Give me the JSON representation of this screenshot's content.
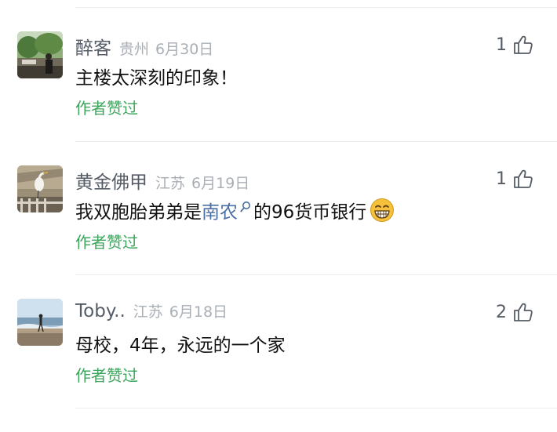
{
  "comments": [
    {
      "name": "醉客",
      "location": "贵州",
      "date": "6月30日",
      "text": "主楼太深刻的印象！",
      "author_liked": "作者赞过",
      "likes": "1",
      "avatar_icon": "avatar-photo-trees-person"
    },
    {
      "name": "黄金佛甲",
      "location": "江苏",
      "date": "6月19日",
      "text_before": "我双胞胎弟弟是",
      "link": "南农",
      "text_after": "的96货币银行",
      "emoji": "grinning-emoji",
      "author_liked": "作者赞过",
      "likes": "1",
      "avatar_icon": "avatar-photo-heron"
    },
    {
      "name": "Toby..",
      "location": "江苏",
      "date": "6月18日",
      "text": "母校，4年，永远的一个家",
      "author_liked": "作者赞过",
      "likes": "2",
      "avatar_icon": "avatar-photo-beach-person"
    }
  ],
  "colors": {
    "name": "#555c65",
    "meta": "#a9afb6",
    "author_liked": "#3ca55c",
    "link": "#4a6fa5"
  }
}
